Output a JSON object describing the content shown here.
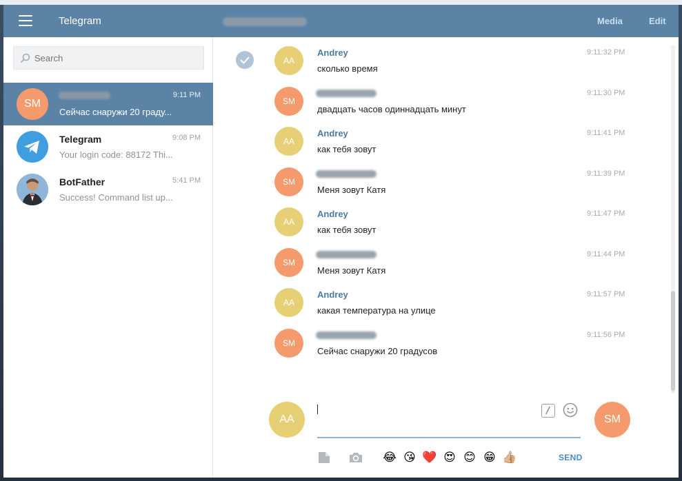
{
  "header": {
    "app_title": "Telegram",
    "media_label": "Media",
    "edit_label": "Edit"
  },
  "search": {
    "placeholder": "Search"
  },
  "dialogs": [
    {
      "avatar_initials": "SM",
      "avatar_color": "#f59a6c",
      "time": "9:11 PM",
      "preview": "Сейчас снаружи 20 граду...",
      "active": true
    },
    {
      "name": "Telegram",
      "avatar_icon": "telegram-logo-icon",
      "avatar_color": "#3f9de0",
      "time": "9:08 PM",
      "preview": "Your login code: 88172 Thi..."
    },
    {
      "name": "BotFather",
      "avatar_icon": "botfather-avatar",
      "time": "5:41 PM",
      "preview": "Success! Command list up..."
    }
  ],
  "messages": [
    {
      "author": "Andrey",
      "initials": "AA",
      "color": "#e6cf74",
      "text": "сколько время",
      "time": "9:11:32 PM"
    },
    {
      "initials": "SM",
      "color": "#f59a6c",
      "text": "двадцать часов одиннадцать минут",
      "time": "9:11:30 PM"
    },
    {
      "author": "Andrey",
      "initials": "AA",
      "color": "#e6cf74",
      "text": "как тебя зовут",
      "time": "9:11:41 PM"
    },
    {
      "initials": "SM",
      "color": "#f59a6c",
      "text": "Меня зовут Катя",
      "time": "9:11:39 PM"
    },
    {
      "author": "Andrey",
      "initials": "AA",
      "color": "#e6cf74",
      "text": "как тебя зовут",
      "time": "9:11:47 PM"
    },
    {
      "initials": "SM",
      "color": "#f59a6c",
      "text": "Меня зовут Катя",
      "time": "9:11:44 PM"
    },
    {
      "author": "Andrey",
      "initials": "AA",
      "color": "#e6cf74",
      "text": "какая температура на улице",
      "time": "9:11:57 PM"
    },
    {
      "initials": "SM",
      "color": "#f59a6c",
      "text": "Сейчас снаружи 20 градусов",
      "time": "9:11:56 PM"
    }
  ],
  "composer": {
    "my_initials": "AA",
    "peer_initials": "SM",
    "send_label": "SEND",
    "emojis": [
      "😂",
      "😘",
      "❤️",
      "😍",
      "😊",
      "😁",
      "👍🏼"
    ]
  },
  "colors": {
    "header": "#5b83a6",
    "accent": "#4a8ac9",
    "author": "#4d7ba0"
  }
}
